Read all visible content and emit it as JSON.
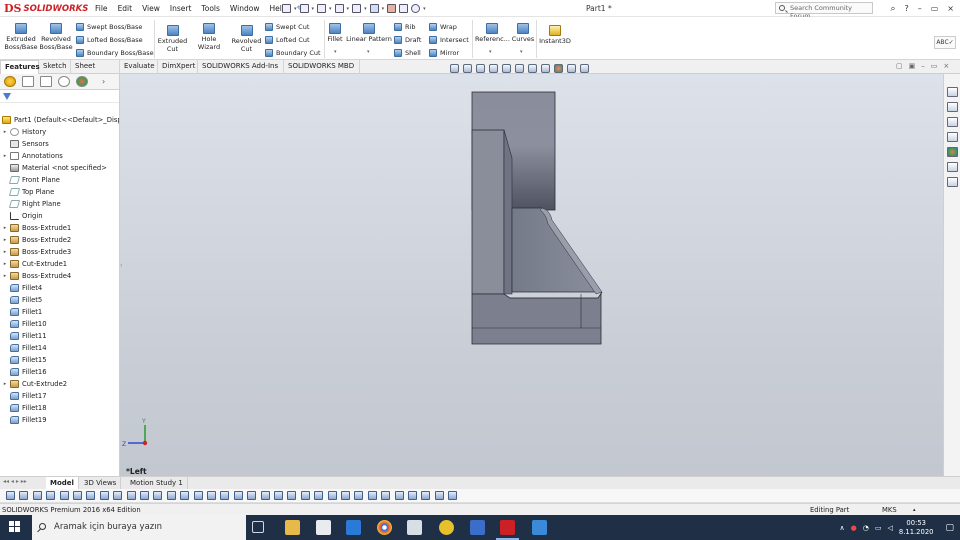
{
  "titlebar": {
    "brand": "SOLIDWORKS",
    "menu": [
      "File",
      "Edit",
      "View",
      "Insert",
      "Tools",
      "Window",
      "Help"
    ],
    "document_title": "Part1 *",
    "search_placeholder": "Search Community Forum",
    "window_controls": [
      "?",
      "–",
      "▭",
      "×"
    ]
  },
  "ribbon": {
    "extruded_boss": "Extruded Boss/Base",
    "revolved_boss": "Revolved Boss/Base",
    "swept_boss": "Swept Boss/Base",
    "lofted_boss": "Lofted Boss/Base",
    "boundary_boss": "Boundary Boss/Base",
    "extruded_cut": "Extruded Cut",
    "hole_wizard": "Hole Wizard",
    "revolved_cut": "Revolved Cut",
    "swept_cut": "Swept Cut",
    "lofted_cut": "Lofted Cut",
    "boundary_cut": "Boundary Cut",
    "fillet": "Fillet",
    "linear_pattern": "Linear Pattern",
    "rib": "Rib",
    "draft": "Draft",
    "shell": "Shell",
    "wrap": "Wrap",
    "intersect": "Intersect",
    "mirror": "Mirror",
    "reference": "Referenc...",
    "curves": "Curves",
    "instant3d": "Instant3D"
  },
  "command_tabs": [
    "Features",
    "Sketch",
    "Sheet Metal",
    "Evaluate",
    "DimXpert",
    "SOLIDWORKS Add-Ins",
    "SOLIDWORKS MBD"
  ],
  "tree": {
    "root": "Part1  (Default<<Default>_Disp",
    "items": [
      {
        "label": "History",
        "icon": "history-icon",
        "expandable": true
      },
      {
        "label": "Sensors",
        "icon": "sensor-icon",
        "expandable": false
      },
      {
        "label": "Annotations",
        "icon": "annotations-icon",
        "expandable": true
      },
      {
        "label": "Material <not specified>",
        "icon": "material-icon",
        "expandable": false
      },
      {
        "label": "Front Plane",
        "icon": "plane-icon",
        "expandable": false
      },
      {
        "label": "Top Plane",
        "icon": "plane-icon",
        "expandable": false
      },
      {
        "label": "Right Plane",
        "icon": "plane-icon",
        "expandable": false
      },
      {
        "label": "Origin",
        "icon": "origin-icon",
        "expandable": false
      },
      {
        "label": "Boss-Extrude1",
        "icon": "extrude-icon",
        "expandable": true
      },
      {
        "label": "Boss-Extrude2",
        "icon": "extrude-icon",
        "expandable": true
      },
      {
        "label": "Boss-Extrude3",
        "icon": "extrude-icon",
        "expandable": true
      },
      {
        "label": "Cut-Extrude1",
        "icon": "cut-icon",
        "expandable": true
      },
      {
        "label": "Boss-Extrude4",
        "icon": "extrude-icon",
        "expandable": true
      },
      {
        "label": "Fillet4",
        "icon": "fillet-icon",
        "expandable": false
      },
      {
        "label": "Fillet5",
        "icon": "fillet-icon",
        "expandable": false
      },
      {
        "label": "Fillet1",
        "icon": "fillet-icon",
        "expandable": false
      },
      {
        "label": "Fillet10",
        "icon": "fillet-icon",
        "expandable": false
      },
      {
        "label": "Fillet11",
        "icon": "fillet-icon",
        "expandable": false
      },
      {
        "label": "Fillet14",
        "icon": "fillet-icon",
        "expandable": false
      },
      {
        "label": "Fillet15",
        "icon": "fillet-icon",
        "expandable": false
      },
      {
        "label": "Fillet16",
        "icon": "fillet-icon",
        "expandable": false
      },
      {
        "label": "Cut-Extrude2",
        "icon": "cut-icon",
        "expandable": true
      },
      {
        "label": "Fillet17",
        "icon": "fillet-icon",
        "expandable": false
      },
      {
        "label": "Fillet18",
        "icon": "fillet-icon",
        "expandable": false
      },
      {
        "label": "Fillet19",
        "icon": "fillet-icon",
        "expandable": false
      }
    ]
  },
  "viewport": {
    "view_name": "*Left",
    "triad_y": "Y",
    "triad_z": "Z"
  },
  "bottom_tabs": [
    "Model",
    "3D Views",
    "Motion Study 1"
  ],
  "status": {
    "product": "SOLIDWORKS Premium 2016 x64 Edition",
    "mode": "Editing Part",
    "units": "MKS"
  },
  "taskbar": {
    "search_placeholder": "Aramak için buraya yazın",
    "time": "00:53",
    "date": "8.11.2020"
  },
  "colors": {
    "accent_red": "#cc1f26",
    "part_gray": "#7a7f8f",
    "viewport_bg": "#d3d8e0",
    "taskbar": "#1f2f45"
  }
}
